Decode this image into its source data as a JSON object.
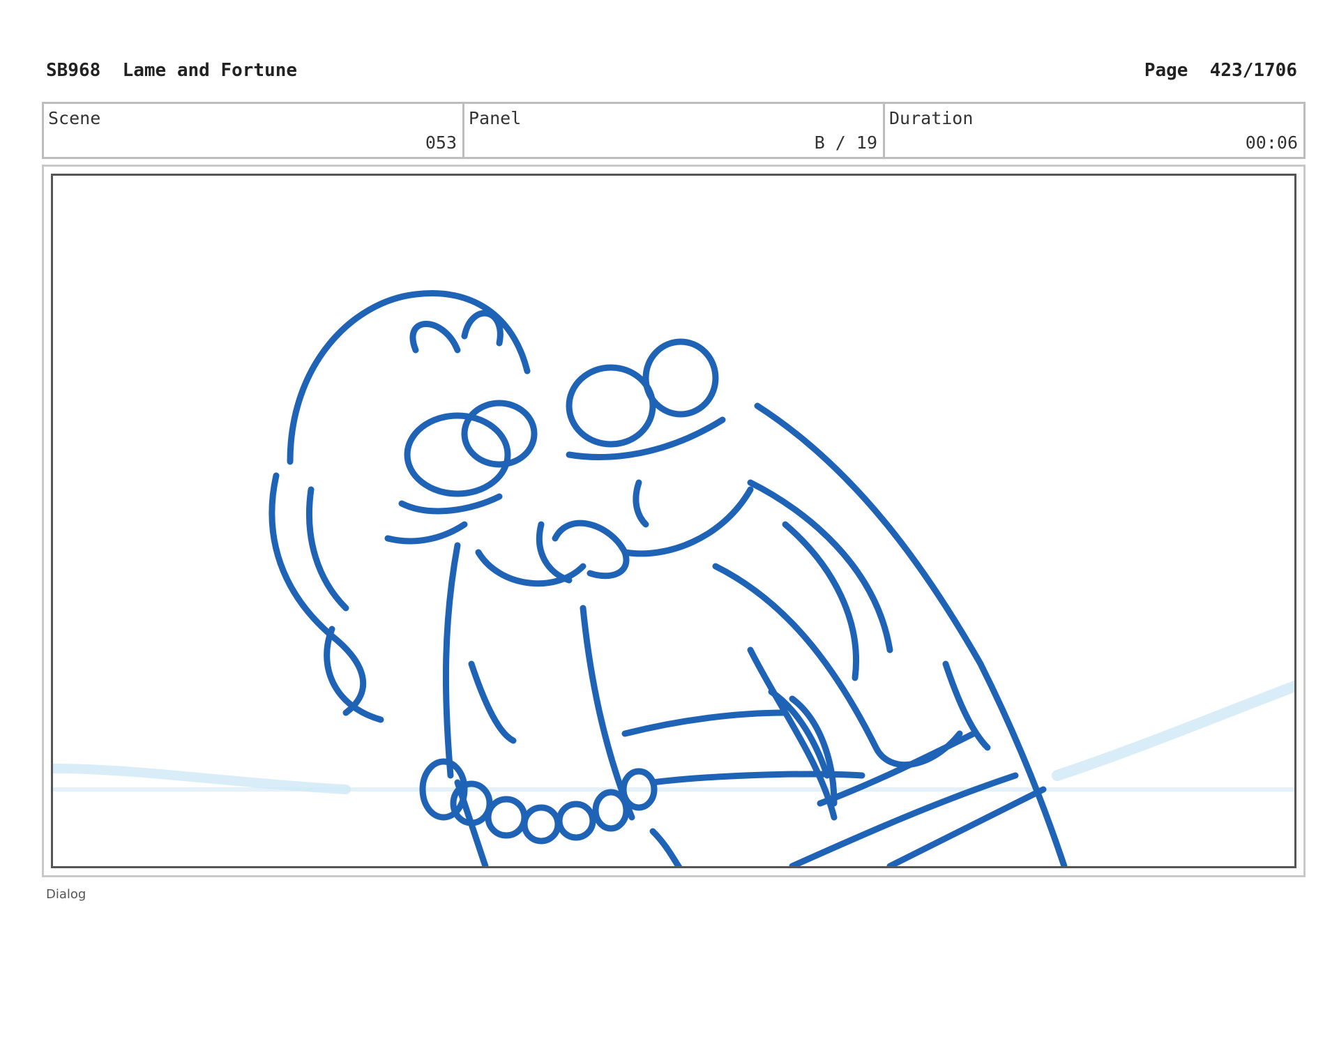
{
  "header": {
    "title": "SB968  Lame and Fortune",
    "page": "Page  423/1706"
  },
  "meta": {
    "scene_label": "Scene",
    "scene_value": "053",
    "panel_label": "Panel",
    "panel_value": "B / 19",
    "duration_label": "Duration",
    "duration_value": "00:06"
  },
  "panel": {
    "sketch_icon": "storyboard-sketch",
    "stroke_color": "#1e63b5",
    "background_wash_color": "#cfe8f6"
  },
  "dialog": {
    "label": "Dialog"
  }
}
